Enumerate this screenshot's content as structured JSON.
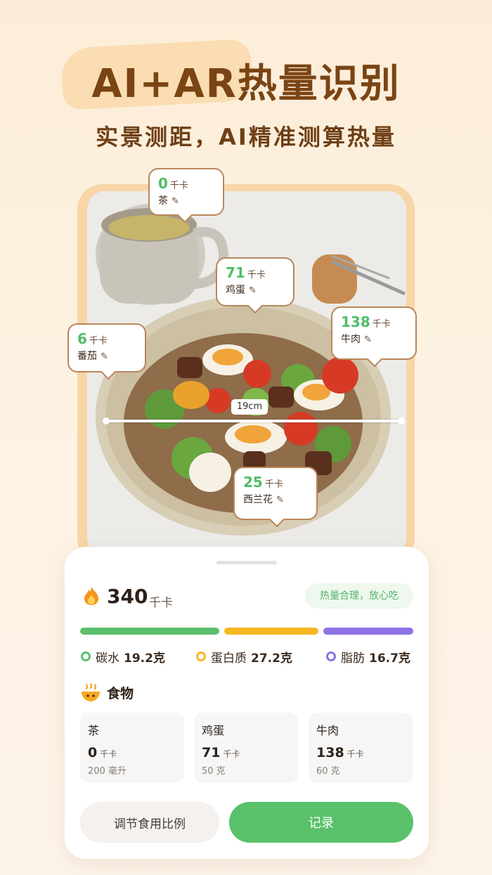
{
  "hero": {
    "title": "AI+AR热量识别",
    "subtitle": "实景测距，AI精准测算热量"
  },
  "photo": {
    "distance_label": "19cm"
  },
  "bubbles": [
    {
      "kcal": "0",
      "unit": "千卡",
      "name": "茶"
    },
    {
      "kcal": "71",
      "unit": "千卡",
      "name": "鸡蛋"
    },
    {
      "kcal": "6",
      "unit": "千卡",
      "name": "番茄"
    },
    {
      "kcal": "138",
      "unit": "千卡",
      "name": "牛肉"
    },
    {
      "kcal": "25",
      "unit": "千卡",
      "name": "西兰花"
    }
  ],
  "summary": {
    "total_kcal": "340",
    "unit": "千卡",
    "status": "热量合理，放心吃"
  },
  "macros": [
    {
      "label": "碳水",
      "value": "19.2克",
      "color": "#5cc06d"
    },
    {
      "label": "蛋白质",
      "value": "27.2克",
      "color": "#f5b820"
    },
    {
      "label": "脂肪",
      "value": "16.7克",
      "color": "#8d72e6"
    }
  ],
  "food_section": {
    "title": "食物",
    "items": [
      {
        "name": "茶",
        "kcal": "0",
        "unit": "千卡",
        "amount": "200 毫升"
      },
      {
        "name": "鸡蛋",
        "kcal": "71",
        "unit": "千卡",
        "amount": "50 克"
      },
      {
        "name": "牛肉",
        "kcal": "138",
        "unit": "千卡",
        "amount": "60 克"
      }
    ]
  },
  "actions": {
    "adjust_label": "调节食用比例",
    "record_label": "记录"
  },
  "colors": {
    "accent_green": "#59c16a",
    "title_brown": "#7a4414",
    "bubble_border": "#b8865b"
  }
}
